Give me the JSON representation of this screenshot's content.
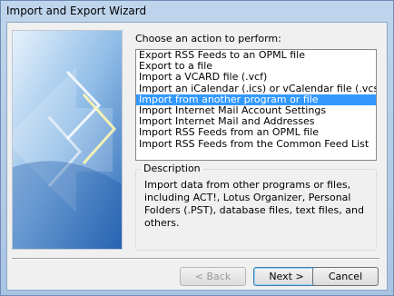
{
  "window": {
    "title": "Import and Export Wizard"
  },
  "main": {
    "prompt": "Choose an action to perform:",
    "actions": [
      "Export RSS Feeds to an OPML file",
      "Export to a file",
      "Import a VCARD file (.vcf)",
      "Import an iCalendar (.ics) or vCalendar file (.vcs)",
      "Import from another program or file",
      "Import Internet Mail Account Settings",
      "Import Internet Mail and Addresses",
      "Import RSS Feeds from an OPML file",
      "Import RSS Feeds from the Common Feed List"
    ],
    "selected_index": 4,
    "description_label": "Description",
    "description": "Import data from other programs or files, including ACT!, Lotus Organizer, Personal Folders (.PST), database files, text files, and others."
  },
  "buttons": {
    "back": "< Back",
    "next": "Next >",
    "cancel": "Cancel"
  },
  "colors": {
    "selection": "#3399ff",
    "title_bar": "#bfd5ec"
  }
}
